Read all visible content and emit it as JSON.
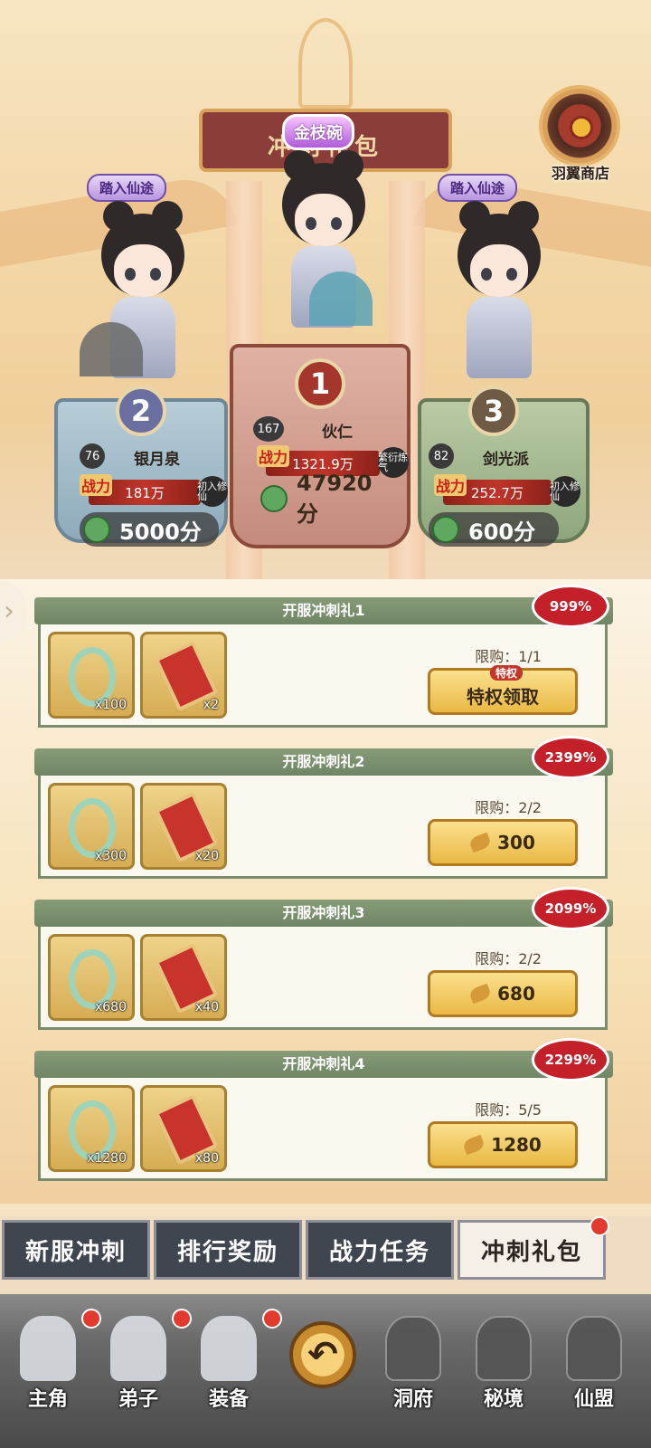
{
  "header": {
    "banner_title": "冲刺礼包",
    "top_badge": "金枝碗",
    "shop_label": "羽翼商店"
  },
  "podium": [
    {
      "rank": "2",
      "badge": "踏入仙途",
      "level": "76",
      "name": "银月泉",
      "power": "181万",
      "power_tag": "初入修仙",
      "score": "5000分"
    },
    {
      "rank": "1",
      "badge": "",
      "level": "167",
      "name": "伙仁",
      "power": "1321.9万",
      "power_tag": "繁衍炼气",
      "score": "47920分"
    },
    {
      "rank": "3",
      "badge": "踏入仙途",
      "level": "82",
      "name": "剑光派",
      "power": "252.7万",
      "power_tag": "初入修仙",
      "score": "600分"
    }
  ],
  "labels": {
    "power_prefix": "战力"
  },
  "packages": [
    {
      "title": "开服冲刺礼1",
      "items": [
        {
          "icon": "jade-ring-icon",
          "qty": "x100"
        },
        {
          "icon": "scroll-icon",
          "qty": "x2"
        }
      ],
      "limit": "限购：1/1",
      "button": "特权领取",
      "button_tag": "特权",
      "price": "",
      "discount": "999%"
    },
    {
      "title": "开服冲刺礼2",
      "items": [
        {
          "icon": "jade-ring-icon",
          "qty": "x300"
        },
        {
          "icon": "scroll-icon",
          "qty": "x20"
        }
      ],
      "limit": "限购：2/2",
      "button": "300",
      "button_tag": "",
      "discount": "2399%"
    },
    {
      "title": "开服冲刺礼3",
      "items": [
        {
          "icon": "jade-ring-icon",
          "qty": "x680"
        },
        {
          "icon": "scroll-icon",
          "qty": "x40"
        }
      ],
      "limit": "限购：2/2",
      "button": "680",
      "button_tag": "",
      "discount": "2099%"
    },
    {
      "title": "开服冲刺礼4",
      "items": [
        {
          "icon": "jade-ring-icon",
          "qty": "x1280"
        },
        {
          "icon": "scroll-icon",
          "qty": "x80"
        }
      ],
      "limit": "限购：5/5",
      "button": "1280",
      "button_tag": "",
      "discount": "2299%"
    }
  ],
  "tabs": [
    {
      "label": "新服冲刺",
      "active": false
    },
    {
      "label": "排行奖励",
      "active": false
    },
    {
      "label": "战力任务",
      "active": false
    },
    {
      "label": "冲刺礼包",
      "active": true
    }
  ],
  "nav": [
    {
      "label": "主角",
      "badge": true
    },
    {
      "label": "弟子",
      "badge": true
    },
    {
      "label": "装备",
      "badge": true
    },
    {
      "label": "洞府",
      "badge": false
    },
    {
      "label": "秘境",
      "badge": false
    },
    {
      "label": "仙盟",
      "badge": false
    }
  ],
  "colors": {
    "accent_red": "#c3202a",
    "tab_dark": "#3f4650",
    "gold": "#e9b944"
  }
}
